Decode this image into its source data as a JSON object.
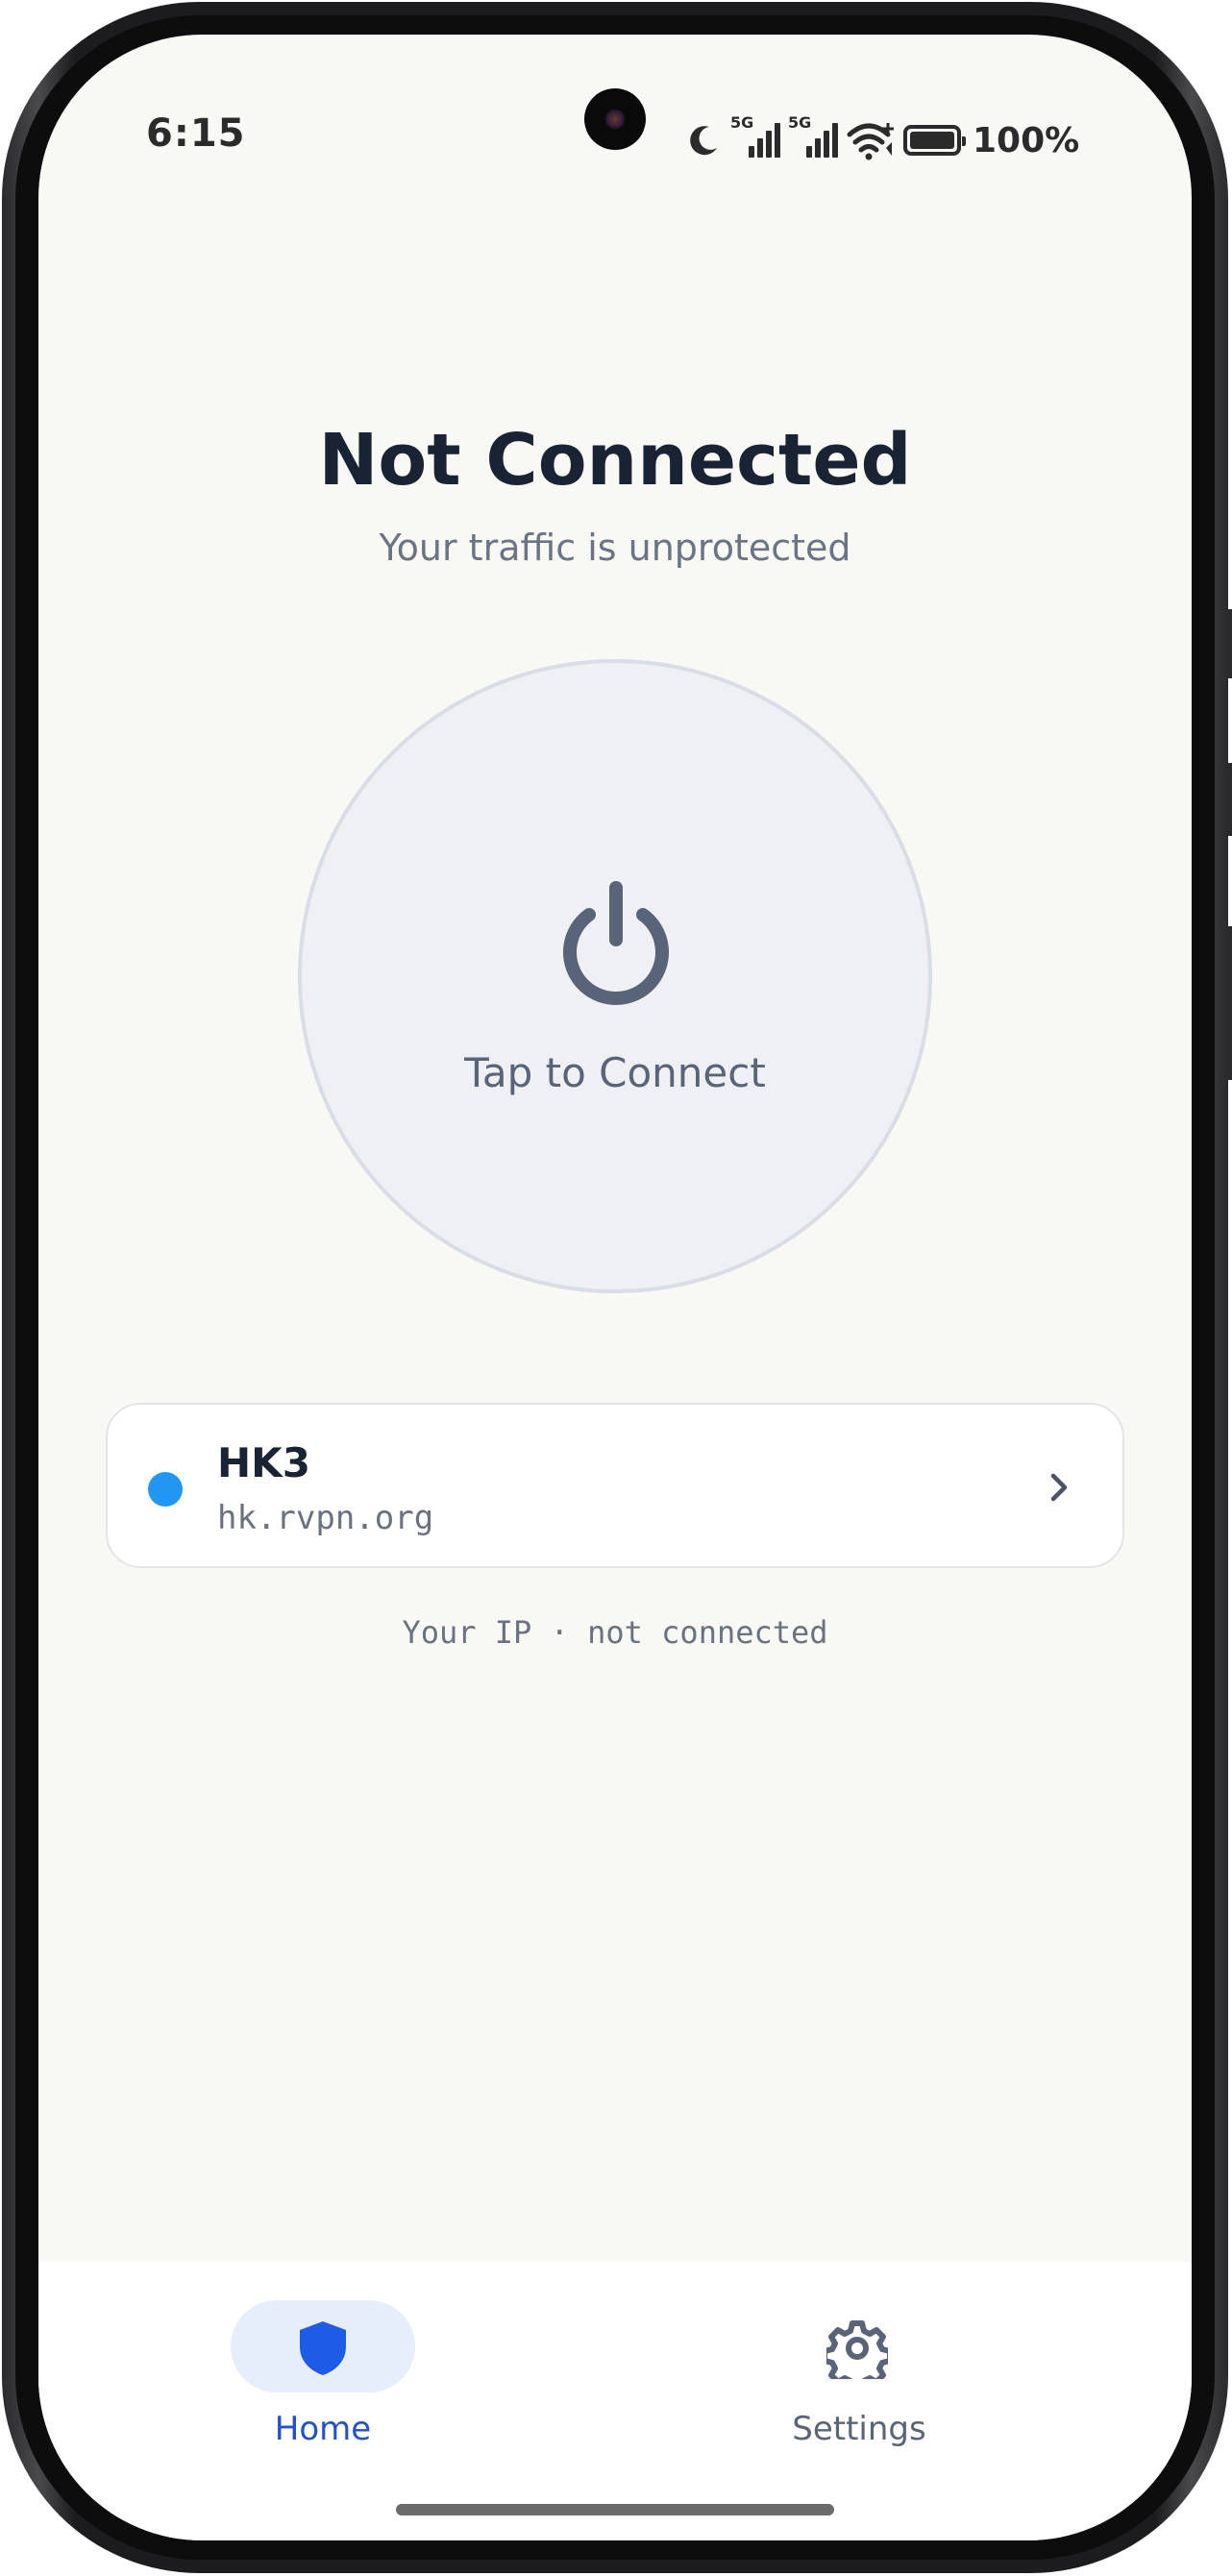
{
  "status_bar": {
    "time": "6:15",
    "signal1_label": "5G",
    "signal2_label": "5G",
    "battery_percent": "100%",
    "battery_level": 1.0,
    "icons": [
      "moon-icon",
      "signal-icon",
      "signal-icon",
      "wifi-icon",
      "battery-icon"
    ]
  },
  "main": {
    "title": "Not Connected",
    "subtitle": "Your traffic is unprotected",
    "connect_label": "Tap to Connect",
    "connect_icon": "power-icon"
  },
  "server": {
    "name": "HK3",
    "host": "hk.rvpn.org",
    "status_color": "#2196f3"
  },
  "ip_line": "Your IP · not connected",
  "nav": {
    "items": [
      {
        "label": "Home",
        "icon": "shield-icon",
        "active": true
      },
      {
        "label": "Settings",
        "icon": "gear-icon",
        "active": false
      }
    ]
  },
  "colors": {
    "accent": "#1e5be6",
    "accent_label": "#2351c8",
    "accent_pill": "#e6edfb",
    "muted_icon": "#5a6478",
    "background": "#f8f8f5"
  }
}
